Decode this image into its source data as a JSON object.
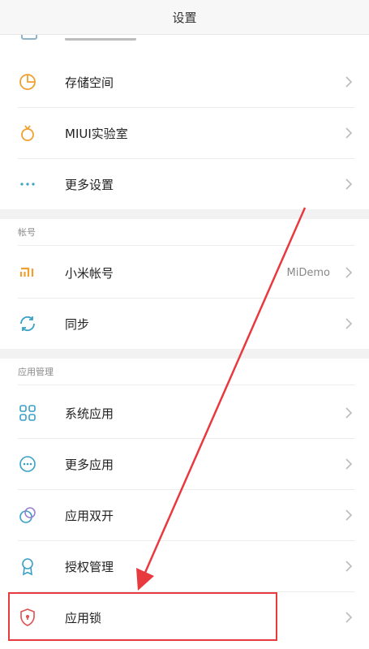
{
  "header": {
    "title": "设置"
  },
  "rows": {
    "storage": {
      "label": "存储空间",
      "icon": "pie-chart-icon"
    },
    "miui_lab": {
      "label": "MIUI实验室",
      "icon": "flask-icon"
    },
    "more_settings": {
      "label": "更多设置",
      "icon": "more-dots-icon"
    },
    "mi_account": {
      "label": "小米帐号",
      "value": "MiDemo",
      "icon": "mi-logo-icon"
    },
    "sync": {
      "label": "同步",
      "icon": "sync-icon"
    },
    "system_apps": {
      "label": "系统应用",
      "icon": "grid-icon"
    },
    "more_apps": {
      "label": "更多应用",
      "icon": "more-circle-icon"
    },
    "dual_apps": {
      "label": "应用双开",
      "icon": "dual-circles-icon"
    },
    "permissions": {
      "label": "授权管理",
      "icon": "badge-icon"
    },
    "app_lock": {
      "label": "应用锁",
      "icon": "shield-lock-icon"
    }
  },
  "sections": {
    "account": {
      "title": "帐号"
    },
    "app_management": {
      "title": "应用管理"
    }
  },
  "colors": {
    "icon_primary": "#3aa0c8",
    "icon_accent": "#f0a030",
    "annotation_red": "#e8393f"
  }
}
